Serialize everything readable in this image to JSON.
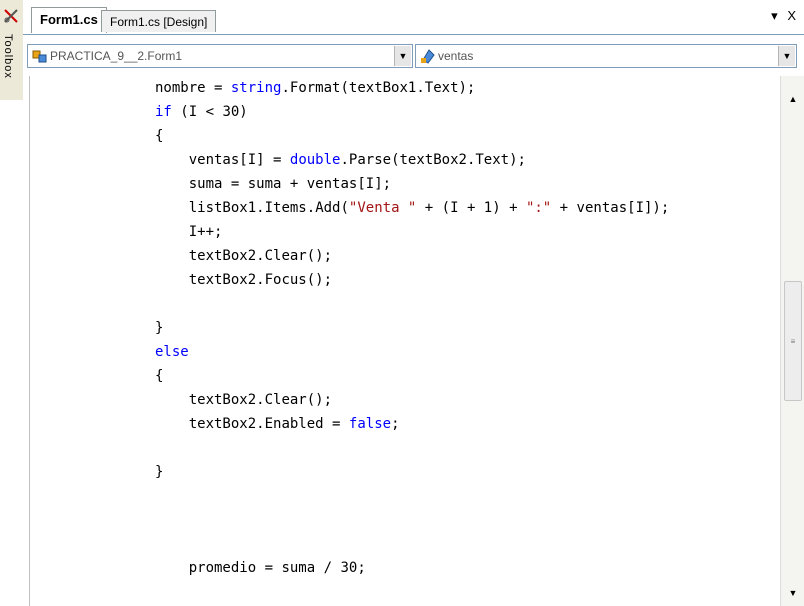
{
  "toolbox": {
    "label": "Toolbox"
  },
  "tabs": [
    {
      "label": "Form1.cs",
      "active": true
    },
    {
      "label": "Form1.cs [Design]",
      "active": false
    }
  ],
  "tab_controls": {
    "dropdown": "▾",
    "close": "X"
  },
  "navbar": {
    "class_combo": "PRACTICA_9__2.Form1",
    "member_combo": "ventas"
  },
  "code": {
    "lines": [
      "nombre = string.Format(textBox1.Text);",
      "if (I < 30)",
      "{",
      "    ventas[I] = double.Parse(textBox2.Text);",
      "    suma = suma + ventas[I];",
      "    listBox1.Items.Add(\"Venta \" + (I + 1) + \":\" + ventas[I]);",
      "    I++;",
      "    textBox2.Clear();",
      "    textBox2.Focus();",
      "",
      "}",
      "else",
      "{",
      "    textBox2.Clear();",
      "    textBox2.Enabled = false;",
      "",
      "}",
      "",
      "",
      "",
      "    promedio = suma / 30;"
    ]
  },
  "colors": {
    "keyword": "#0000ff",
    "string": "#a31515",
    "text": "#000000"
  }
}
